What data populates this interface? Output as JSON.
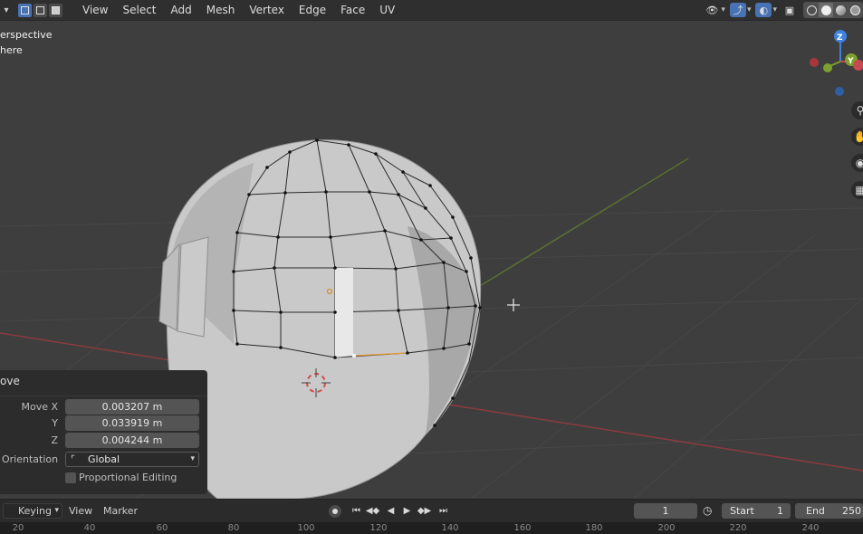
{
  "header": {
    "menus": [
      "View",
      "Select",
      "Add",
      "Mesh",
      "Vertex",
      "Edge",
      "Face",
      "UV"
    ],
    "select_modes": [
      "vertex-select-icon",
      "edge-select-icon",
      "face-select-icon"
    ],
    "right_icons": [
      "visibility-icon",
      "gizmo-icon",
      "overlay-icon",
      "xray-icon"
    ],
    "shading_modes": [
      "wireframe-shading-icon",
      "solid-shading-icon",
      "material-shading-icon",
      "rendered-shading-icon"
    ]
  },
  "viewport": {
    "view_label": "erspective",
    "object_label": "here",
    "gizmo": {
      "z": "Z",
      "y": "Y"
    }
  },
  "operator_panel": {
    "title": "ove",
    "move_x_label": "Move X",
    "move_x": "0.003207 m",
    "y_label": "Y",
    "y": "0.033919 m",
    "z_label": "Z",
    "z": "0.004244 m",
    "orientation_label": "Orientation",
    "orientation": "Global",
    "proportional_editing": "Proportional Editing"
  },
  "timeline": {
    "keying": "Keying",
    "view": "View",
    "marker": "Marker",
    "current_frame": "1",
    "start_label": "Start",
    "start": "1",
    "end_label": "End",
    "end": "250",
    "ruler": [
      "20",
      "40",
      "60",
      "80",
      "100",
      "120",
      "140",
      "160",
      "180",
      "200",
      "220",
      "240"
    ]
  },
  "colors": {
    "accent": "#4772b3",
    "x_axis": "#c64a52",
    "y_axis": "#7ca12e",
    "z_axis": "#3e82df"
  }
}
